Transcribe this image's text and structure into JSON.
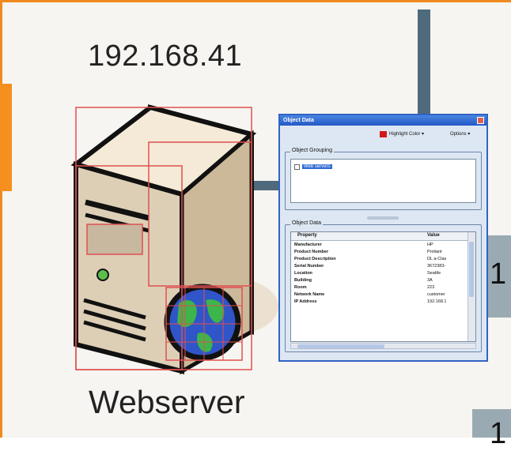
{
  "diagram": {
    "ip_label": "192.168.41",
    "server_caption": "Webserver",
    "side_numbers": [
      "1",
      "1"
    ],
    "colors": {
      "accent_orange": "#f5901e",
      "connector": "#4e6a7c",
      "selection_red": "#e05050"
    }
  },
  "dialog": {
    "title": "Object Data",
    "toolbar": {
      "highlight_label": "Highlight Color ▾",
      "options_label": "Options ▾",
      "highlight_color": "#d01a1a"
    },
    "object_grouping": {
      "title": "Object Grouping",
      "items": [
        "Web servers"
      ]
    },
    "object_data": {
      "title": "Object Data",
      "columns": [
        "Property",
        "Value"
      ],
      "rows": [
        {
          "property": "Manufacturer",
          "value": "HP"
        },
        {
          "property": "Product Number",
          "value": "Proliant"
        },
        {
          "property": "Product Description",
          "value": "DL a-Clas"
        },
        {
          "property": "Serial Number",
          "value": "3672383-"
        },
        {
          "property": "Location",
          "value": "Seattle"
        },
        {
          "property": "Building",
          "value": "3A"
        },
        {
          "property": "Room",
          "value": "223"
        },
        {
          "property": "Network Name",
          "value": "customer"
        },
        {
          "property": "IP Address",
          "value": "192.168.1"
        }
      ]
    }
  }
}
